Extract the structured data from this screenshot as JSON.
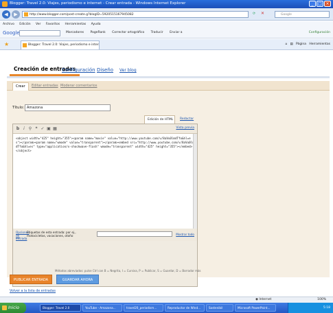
{
  "window": {
    "title": "Blogger: Travel 2.0: Viajes, periodismo e internet - Crear entrada - Windows Internet Explorer"
  },
  "address_bar": {
    "url": "http://www.blogger.com/post-create.g?blogID=5920515167945082",
    "search_placeholder": "Google"
  },
  "menu": [
    "Archivo",
    "Edición",
    "Ver",
    "Favoritos",
    "Herramientas",
    "Ayuda"
  ],
  "google_toolbar": {
    "brand": "Google",
    "items": [
      "Marcadores",
      "PageRank",
      "Corrector ortográfico",
      "Traducir",
      "Enviar a"
    ],
    "settings_label": "Configuración"
  },
  "browser_tab": {
    "label": "Blogger: Travel 2.0: Viajes, periodismo e internet - Cr...",
    "tools": [
      "Página",
      "Herramientas"
    ]
  },
  "blogger": {
    "tabs": [
      "Creación de entradas",
      "Configuración",
      "Diseño",
      "Ver blog"
    ],
    "subtabs": [
      "Crear",
      "Editar entradas",
      "Moderar comentarios"
    ],
    "title_label": "Título:",
    "title_value": "Amazona",
    "mode_tabs": [
      "Edición de HTML",
      "Redactar"
    ],
    "preview_link": "Vista previa",
    "html_content": "<object width=\"425\" height=\"355\"><param name=\"movie\" value=\"http://www.youtube.com/v/8aVu0lmdTfo&hl=es\"></param><param name=\"wmode\" value=\"transparent\"></param><embed src=\"http://www.youtube.com/v/8aVu0lmdTfo&hl=es\" type=\"application/x-shockwave-flash\" wmode=\"transparent\" width=\"425\" height=\"355\"></embed></object>",
    "labels_options": "Opciones de entrada",
    "labels_desc": "Etiquetas de esta entrada: por ej., motocicletas, vacaciones, otoño",
    "show_all": "Mostrar todo",
    "shortcuts": "Métodos abreviados: pulse Ctrl con B = Negrita, I = Cursiva, P = Publicar, S = Guardar, D = Borrador más",
    "publish_button": "PUBLICAR ENTRADA",
    "save_button": "GUARDAR AHORA",
    "back_link": "Volver a la lista de entradas"
  },
  "status_bar": {
    "zone": "Internet",
    "zoom": "100%"
  },
  "taskbar": {
    "start": "Inicio",
    "items": [
      "Blogger: Travel 2.0",
      "YouTube - Amazona...",
      "travel20_periodism...",
      "Reproductor de Wind...",
      "Sostenibil",
      "Microsoft PowerPoint..."
    ],
    "clock": "5:18"
  }
}
